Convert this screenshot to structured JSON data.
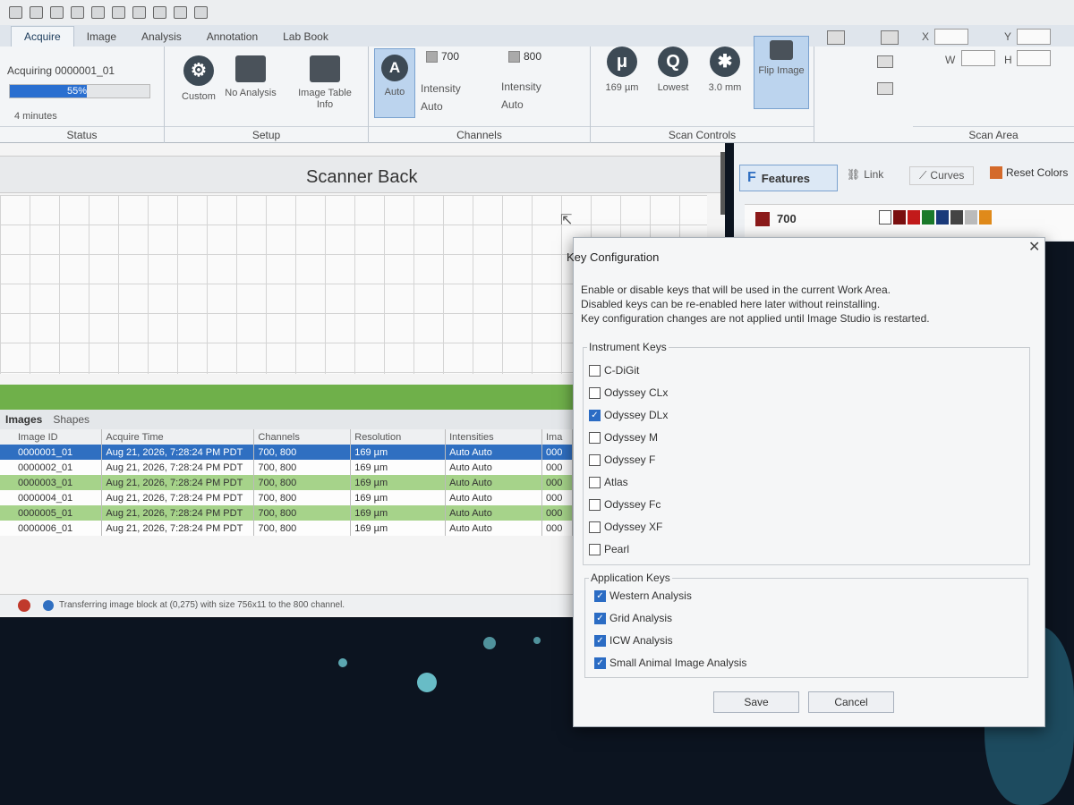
{
  "ribbon": {
    "tabs": [
      "Acquire",
      "Image",
      "Analysis",
      "Annotation",
      "Lab Book"
    ],
    "status": {
      "acquiring": "Acquiring 0000001_01",
      "progress": "55%",
      "progress_value": 55,
      "time": "4 minutes",
      "caption": "Status"
    },
    "setup": {
      "custom": "Custom",
      "no_analysis": "No Analysis",
      "image_table_info": "Image Table Info",
      "caption": "Setup"
    },
    "channels": {
      "auto": "Auto",
      "ch700": "700",
      "ch800": "800",
      "intensity": "Intensity",
      "intensity_auto_a": "Auto",
      "intensity_b": "Intensity",
      "intensity_auto_b": "Auto",
      "caption": "Channels"
    },
    "scan_controls": {
      "resolution": "169 µm",
      "quality": "Lowest",
      "focus": "3.0 mm",
      "flip_image": "Flip Image",
      "caption": "Scan Controls"
    },
    "scan_area": {
      "x": "X",
      "y": "Y",
      "w": "W",
      "h": "H",
      "caption": "Scan Area"
    }
  },
  "scanner": {
    "title": "Scanner Back"
  },
  "right_panel": {
    "features": "Features",
    "link": "Link",
    "curves": "Curves",
    "reset_colors": "Reset Colors",
    "channel": "700"
  },
  "images_panel": {
    "tabs": [
      "Images",
      "Shapes"
    ],
    "columns": [
      "Image ID",
      "Acquire Time",
      "Channels",
      "Resolution",
      "Intensities",
      "Ima"
    ],
    "rows": [
      {
        "id": "0000001_01",
        "time": "Aug 21, 2026, 7:28:24 PM PDT",
        "channels": "700, 800",
        "res": "169 µm",
        "int": "Auto Auto",
        "ima": "000"
      },
      {
        "id": "0000002_01",
        "time": "Aug 21, 2026, 7:28:24 PM PDT",
        "channels": "700, 800",
        "res": "169 µm",
        "int": "Auto Auto",
        "ima": "000"
      },
      {
        "id": "0000003_01",
        "time": "Aug 21, 2026, 7:28:24 PM PDT",
        "channels": "700, 800",
        "res": "169 µm",
        "int": "Auto Auto",
        "ima": "000"
      },
      {
        "id": "0000004_01",
        "time": "Aug 21, 2026, 7:28:24 PM PDT",
        "channels": "700, 800",
        "res": "169 µm",
        "int": "Auto Auto",
        "ima": "000"
      },
      {
        "id": "0000005_01",
        "time": "Aug 21, 2026, 7:28:24 PM PDT",
        "channels": "700, 800",
        "res": "169 µm",
        "int": "Auto Auto",
        "ima": "000"
      },
      {
        "id": "0000006_01",
        "time": "Aug 21, 2026, 7:28:24 PM PDT",
        "channels": "700, 800",
        "res": "169 µm",
        "int": "Auto Auto",
        "ima": "000"
      }
    ],
    "status_message": "Transferring image block at (0,275) with size 756x11 to the 800 channel."
  },
  "dialog": {
    "title": "Key Configuration",
    "desc1": "Enable or disable keys that will be used in the current Work Area.",
    "desc2": "Disabled keys can be re-enabled here later without reinstalling.",
    "desc3": "Key configuration changes are not applied until Image Studio is restarted.",
    "instrument_label": "Instrument Keys",
    "instrument_keys": [
      {
        "label": "C-DiGit",
        "checked": false
      },
      {
        "label": "Odyssey CLx",
        "checked": false
      },
      {
        "label": "Odyssey DLx",
        "checked": true
      },
      {
        "label": "Odyssey M",
        "checked": false
      },
      {
        "label": "Odyssey F",
        "checked": false
      },
      {
        "label": "Atlas",
        "checked": false
      },
      {
        "label": "Odyssey Fc",
        "checked": false
      },
      {
        "label": "Odyssey XF",
        "checked": false
      },
      {
        "label": "Pearl",
        "checked": false
      }
    ],
    "application_label": "Application Keys",
    "application_keys": [
      {
        "label": "Western Analysis",
        "checked": true
      },
      {
        "label": "Grid Analysis",
        "checked": true
      },
      {
        "label": "ICW Analysis",
        "checked": true
      },
      {
        "label": "Small Animal Image Analysis",
        "checked": true
      }
    ],
    "save": "Save",
    "cancel": "Cancel",
    "close": "✕"
  },
  "colors": {
    "accent": "#2f6fc1",
    "row_green": "#a6d38a",
    "panel_green": "#6fb04a"
  }
}
